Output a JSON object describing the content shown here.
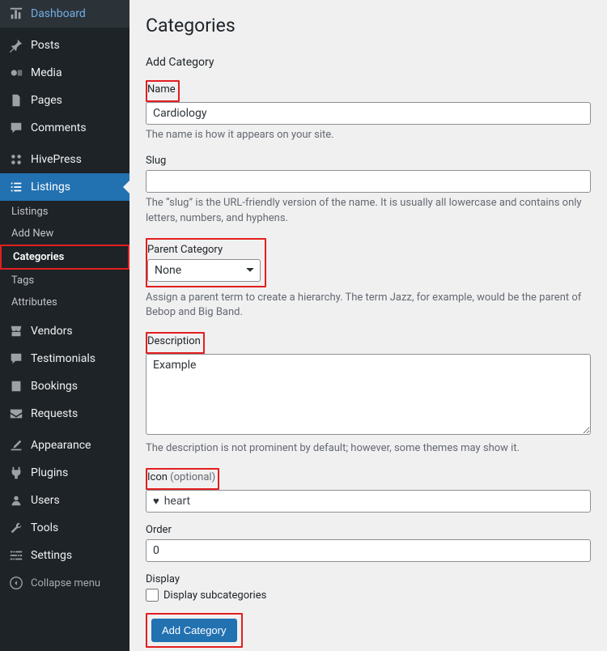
{
  "sidebar": {
    "items": [
      {
        "label": "Dashboard",
        "icon": "dashboard"
      },
      {
        "label": "Posts",
        "icon": "pin"
      },
      {
        "label": "Media",
        "icon": "media"
      },
      {
        "label": "Pages",
        "icon": "pages"
      },
      {
        "label": "Comments",
        "icon": "comments"
      },
      {
        "label": "HivePress",
        "icon": "hivepress"
      },
      {
        "label": "Listings",
        "icon": "listings"
      },
      {
        "label": "Vendors",
        "icon": "vendors"
      },
      {
        "label": "Testimonials",
        "icon": "testimonials"
      },
      {
        "label": "Bookings",
        "icon": "bookings"
      },
      {
        "label": "Requests",
        "icon": "requests"
      },
      {
        "label": "Appearance",
        "icon": "appearance"
      },
      {
        "label": "Plugins",
        "icon": "plugins"
      },
      {
        "label": "Users",
        "icon": "users"
      },
      {
        "label": "Tools",
        "icon": "tools"
      },
      {
        "label": "Settings",
        "icon": "settings"
      }
    ],
    "subnav": [
      "Listings",
      "Add New",
      "Categories",
      "Tags",
      "Attributes"
    ],
    "collapse": "Collapse menu"
  },
  "page": {
    "title": "Categories",
    "section": "Add Category"
  },
  "form": {
    "name": {
      "label": "Name",
      "value": "Cardiology",
      "desc": "The name is how it appears on your site."
    },
    "slug": {
      "label": "Slug",
      "value": "",
      "desc": "The “slug” is the URL-friendly version of the name. It is usually all lowercase and contains only letters, numbers, and hyphens."
    },
    "parent": {
      "label": "Parent Category",
      "value": "None",
      "desc": "Assign a parent term to create a hierarchy. The term Jazz, for example, would be the parent of Bebop and Big Band."
    },
    "description": {
      "label": "Description",
      "value": "Example",
      "desc": "The description is not prominent by default; however, some themes may show it."
    },
    "icon": {
      "label": "Icon ",
      "optional": "(optional)",
      "value": "heart"
    },
    "order": {
      "label": "Order",
      "value": "0"
    },
    "display": {
      "label": "Display",
      "checkbox": "Display subcategories"
    },
    "submit": "Add Category"
  }
}
